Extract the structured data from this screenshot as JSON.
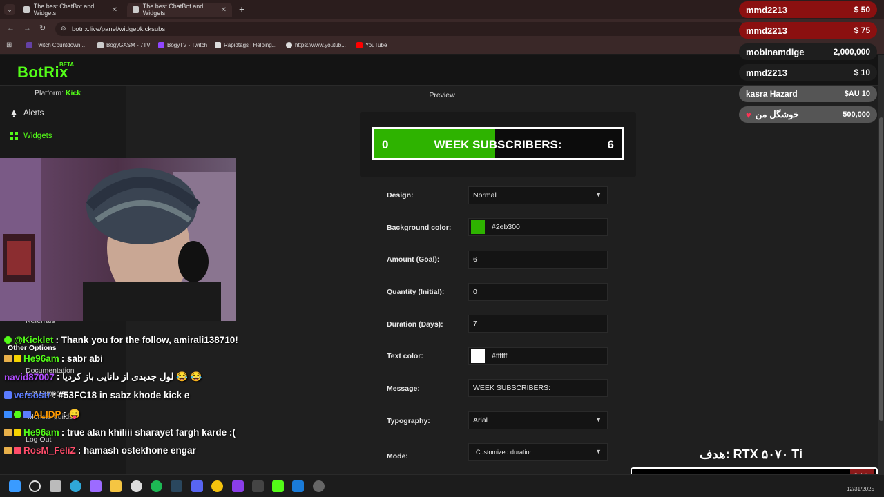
{
  "browser": {
    "tabs": [
      {
        "title": "The best ChatBot and Widgets"
      },
      {
        "title": "The best ChatBot and Widgets"
      }
    ],
    "url": "botrix.live/panel/widget/kicksubs",
    "bookmarks": [
      {
        "label": "Twitch Countdown...",
        "color": "#6441a5"
      },
      {
        "label": "BogyGASM - 7TV",
        "color": "#cccccc"
      },
      {
        "label": "BogyTV - Twitch",
        "color": "#9146ff"
      },
      {
        "label": "Rapidtags | Helping...",
        "color": "#dddddd"
      },
      {
        "label": "https://www.youtub...",
        "color": "#dddddd"
      },
      {
        "label": "YouTube",
        "color": "#ff0000"
      }
    ]
  },
  "app": {
    "logo": "BotRix",
    "beta": "BETA",
    "platform_label": "Platform:",
    "platform_value": "Kick",
    "nav": [
      {
        "label": "Alerts",
        "icon": "bell-icon"
      },
      {
        "label": "Widgets",
        "icon": "widget-icon"
      }
    ],
    "nav_partial": [
      "Referrals",
      "Other Options",
      "Documentation",
      "Get Support",
      "Monsterguilds",
      "Log Out"
    ]
  },
  "preview": {
    "title": "Preview",
    "initial": "0",
    "message": "WEEK SUBSCRIBERS:",
    "goal": "6",
    "progress": 0.49
  },
  "form": {
    "design": {
      "label": "Design:",
      "value": "Normal"
    },
    "bg_color": {
      "label": "Background color:",
      "value": "#2eb300",
      "swatch": "#2eb300"
    },
    "amount": {
      "label": "Amount (Goal):",
      "value": "6"
    },
    "quantity": {
      "label": "Quantity (Initial):",
      "value": "0"
    },
    "duration": {
      "label": "Duration (Days):",
      "value": "7"
    },
    "text_color": {
      "label": "Text color:",
      "value": "#ffffff",
      "swatch": "#ffffff"
    },
    "message": {
      "label": "Message:",
      "value": "WEEK SUBSCRIBERS:"
    },
    "typography": {
      "label": "Typography:",
      "value": "Arial"
    },
    "mode": {
      "label": "Mode:",
      "value": "Customized duration"
    }
  },
  "chat": [
    {
      "user": "@Kicklet",
      "text": " : Thank you for the follow, amirali138710!",
      "color": "#53fc18"
    },
    {
      "user": "He96am",
      "text": " : sabr abi",
      "color": "#53fc18"
    },
    {
      "user": "navid87007",
      "text": " : لول جدیدی از دانایی باز کردیا 😂 😂",
      "color": "#b14cff"
    },
    {
      "user": "versostr",
      "text": " : #53FC18 in sabz khode kick e",
      "color": "#5b7cff"
    },
    {
      "user": "ALIDP",
      "text": " : 😛",
      "color": "#ff9900"
    },
    {
      "user": "He96am",
      "text": " : true alan khiliii sharayet fargh karde :(",
      "color": "#53fc18"
    },
    {
      "user": "RosM_FeliZ",
      "text": " : hamash ostekhone engar",
      "color": "#ff4d6a"
    }
  ],
  "donations": [
    {
      "name": "mmd2213",
      "amount": "$ 50",
      "color": "#8b1010"
    },
    {
      "name": "mmd2213",
      "amount": "$ 75",
      "color": "#8b1010"
    },
    {
      "name": "mobinamdige",
      "amount": "2,000,000",
      "color": "#1e1e1e"
    },
    {
      "name": "mmd2213",
      "amount": "$ 10",
      "color": "#1e1e1e"
    },
    {
      "name": "kasra Hazard",
      "amount": "$AU 10",
      "color": "#555555"
    },
    {
      "name": "خوشگل من",
      "amount": "500,000",
      "color": "#555555"
    }
  ],
  "goal_overlay": {
    "title": "هدف: RTX ۵۰۷۰ Ti",
    "percent": "%۱"
  },
  "taskbar": {
    "clock_date": "12/31/2025"
  },
  "colors": {
    "accent": "#53fc18",
    "bar_fill": "#2eb300"
  }
}
